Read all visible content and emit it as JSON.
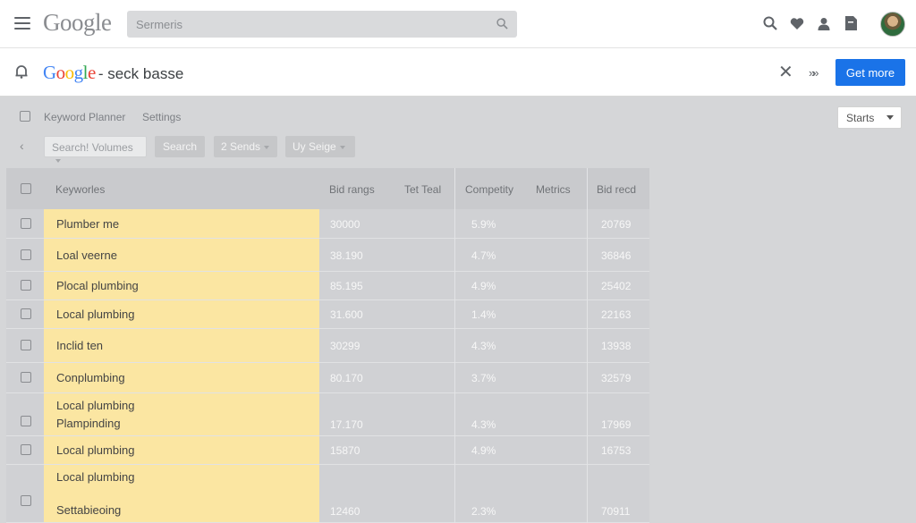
{
  "header": {
    "logo_letters": [
      "G",
      "o",
      "o",
      "g",
      "l",
      "e"
    ],
    "search_placeholder": "Sermeris"
  },
  "subheader": {
    "logo_letters": [
      "G",
      "o",
      "o",
      "g",
      "l",
      "e"
    ],
    "title": "- seck basse",
    "close_glyph": "✕",
    "forward_glyph": "»»",
    "get_more_label": "Get more"
  },
  "nav": {
    "keyword_planner": "Keyword Planner",
    "settings": "Settings",
    "starts_label": "Starts"
  },
  "toolbar": {
    "back_glyph": "‹",
    "search_volumes": "Search! Volumes",
    "search_button": "Search",
    "sends": "2 Sends",
    "uy_seige": "Uy Seige"
  },
  "table": {
    "headers": {
      "keywords": "Keyworles",
      "bid_ranges": "Bid rangs",
      "tet_teal": "Tet Teal",
      "competition": "Competity",
      "metrics": "Metrics",
      "bid_record": "Bid recd"
    },
    "rows": [
      {
        "lines": [
          "Plumber me"
        ],
        "bid": "30000",
        "comp": "5.9%",
        "rec": "20769"
      },
      {
        "lines": [
          "Loal veerne"
        ],
        "bid": "38.190",
        "comp": "4.7%",
        "rec": "36846"
      },
      {
        "lines": [
          "Plocal plumbing"
        ],
        "bid": "85.195",
        "comp": "4.9%",
        "rec": "25402"
      },
      {
        "lines": [
          "Local plumbing"
        ],
        "bid": "31.600",
        "comp": "1.4%",
        "rec": "22163"
      },
      {
        "lines": [
          "Inclid ten"
        ],
        "bid": "30299",
        "comp": "4.3%",
        "rec": "13938"
      },
      {
        "lines": [
          "Conplumbing"
        ],
        "bid": "80.170",
        "comp": "3.7%",
        "rec": "32579"
      },
      {
        "lines": [
          "Local plumbing",
          "Plampinding"
        ],
        "bid": "17.170",
        "comp": "4.3%",
        "rec": "17969"
      },
      {
        "lines": [
          "Local plumbing"
        ],
        "bid": "15870",
        "comp": "4.9%",
        "rec": "16753"
      },
      {
        "lines": [
          "Local plumbing",
          "Settabieoing"
        ],
        "bid": "12460",
        "comp": "2.3%",
        "rec": "70911"
      }
    ]
  },
  "colors": {
    "accent_blue": "#1a73e8",
    "keyword_highlight": "#fbe6a2",
    "overlay_grey": "#d5d6d8"
  }
}
